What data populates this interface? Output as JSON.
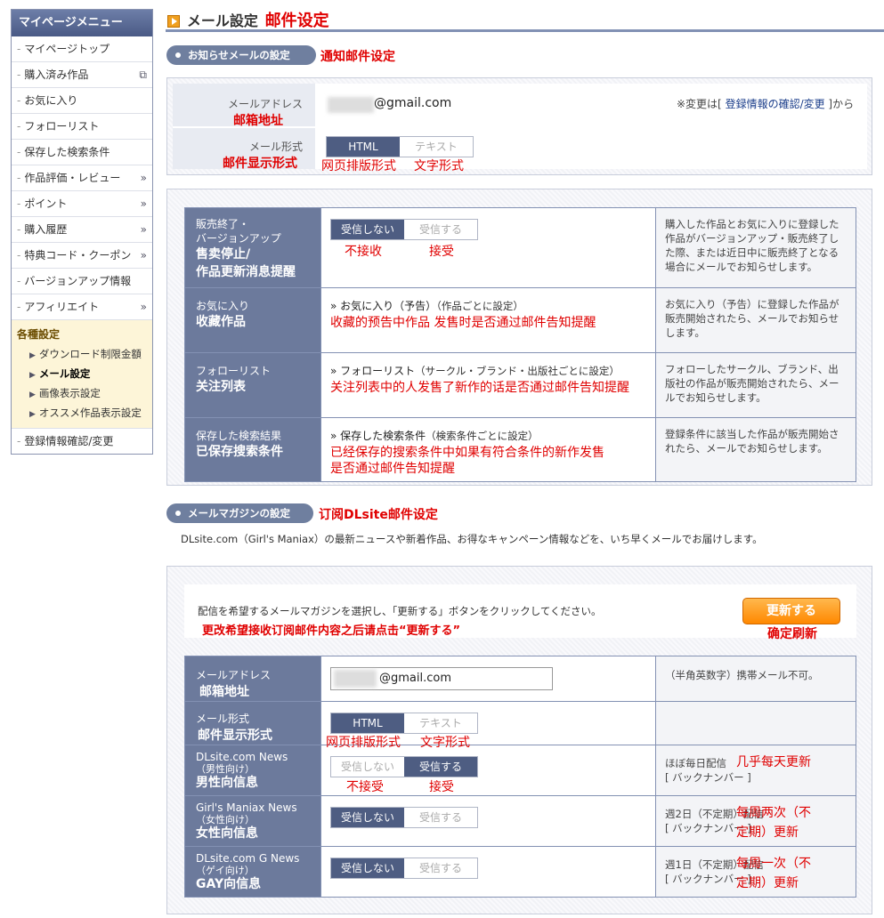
{
  "sidebar": {
    "title": "マイページメニュー",
    "items": [
      {
        "label": "マイページトップ",
        "arrow": ""
      },
      {
        "label": "購入済み作品",
        "arrow": "⧉"
      },
      {
        "label": "お気に入り",
        "arrow": ""
      },
      {
        "label": "フォローリスト",
        "arrow": ""
      },
      {
        "label": "保存した検索条件",
        "arrow": ""
      },
      {
        "label": "作品評価・レビュー",
        "arrow": "»"
      },
      {
        "label": "ポイント",
        "arrow": "»"
      },
      {
        "label": "購入履歴",
        "arrow": "»"
      },
      {
        "label": "特典コード・クーポン",
        "arrow": "»"
      },
      {
        "label": "バージョンアップ情報",
        "arrow": ""
      },
      {
        "label": "アフィリエイト",
        "arrow": "»"
      }
    ],
    "settings_title": "各種設定",
    "settings_items": [
      "ダウンロード制限金額",
      "メール設定",
      "画像表示設定",
      "オススメ作品表示設定"
    ],
    "last_item": "登録情報確認/変更"
  },
  "header": {
    "title": "メール設定",
    "title_zh": "邮件设定"
  },
  "notify": {
    "pill": "お知らせメールの設定",
    "pill_zh": "通知邮件设定",
    "email_label": "メールアドレス",
    "email_zh": "邮箱地址",
    "email_value": "@gmail.com",
    "change_note_pre": "※変更は[ ",
    "change_link": "登録情報の確認/変更",
    "change_note_post": " ]から",
    "format_label": "メール形式",
    "format_zh": "邮件显示形式",
    "html": "HTML",
    "text": "テキスト",
    "html_zh": "网页排版形式",
    "text_zh": "文字形式"
  },
  "rows": [
    {
      "label": "販売終了・\nバージョンアップ",
      "zh": "售卖停止/\n作品更新消息提醒",
      "off": "受信しない",
      "on": "受信する",
      "off_zh": "不接收",
      "on_zh": "接受",
      "desc": "購入した作品とお気に入りに登録した作品がバージョンアップ・販売終了した際、または近日中に販売終了となる場合にメールでお知らせします。"
    },
    {
      "label": "お気に入り",
      "zh": "收藏作品",
      "link": "» お気に入り（予告）",
      "link_note": "（作品ごとに設定）",
      "note_zh": "收藏的预告中作品 发售时是否通过邮件告知提醒",
      "desc": "お気に入り（予告）に登録した作品が販売開始されたら、メールでお知らせします。"
    },
    {
      "label": "フォローリスト",
      "zh": "关注列表",
      "link": "» フォローリスト",
      "link_note": "（サークル・ブランド・出版社ごとに設定）",
      "note_zh": "关注列表中的人发售了新作的话是否通过邮件告知提醒",
      "desc": "フォローしたサークル、ブランド、出版社の作品が販売開始されたら、メールでお知らせします。"
    },
    {
      "label": "保存した検索結果",
      "zh": "已保存搜索条件",
      "link": "» 保存した検索条件",
      "link_note": "（検索条件ごとに設定）",
      "note_zh": "已经保存的搜索条件中如果有符合条件的新作发售\n是否通过邮件告知提醒",
      "desc": "登録条件に該当した作品が販売開始されたら、メールでお知らせします。"
    }
  ],
  "magazine": {
    "pill": "メールマガジンの設定",
    "pill_zh": "订阅DLsite邮件设定",
    "intro": "DLsite.com（Girl's Maniax）の最新ニュースや新着作品、お得なキャンペーン情報などを、いち早くメールでお届けします。",
    "instr": "配信を希望するメールマガジンを選択し、「更新する」ボタンをクリックしてください。",
    "instr_zh": "更改希望接收订阅邮件内容之后请点击“更新する”",
    "update": "更新する",
    "update_zh": "确定刷新",
    "email_label": "メールアドレス",
    "email_zh": "邮箱地址",
    "email_value": "@gmail.com",
    "email_note": "（半角英数字）携帯メール不可。",
    "format_label": "メール形式",
    "format_zh": "邮件显示形式",
    "html": "HTML",
    "text": "テキスト",
    "html_zh": "网页排版形式",
    "text_zh": "文字形式",
    "news": [
      {
        "label": "DLsite.com News",
        "sub": "（男性向け）",
        "zh": "男性向信息",
        "off": "受信しない",
        "on": "受信する",
        "sel": "on",
        "off_zh": "不接受",
        "on_zh": "接受",
        "freq": "ほぼ毎日配信",
        "freq_zh": "几乎每天更新",
        "back": "[ バックナンバー ]"
      },
      {
        "label": "Girl's Maniax News",
        "sub": "（女性向け）",
        "zh": "女性向信息",
        "off": "受信しない",
        "on": "受信する",
        "sel": "off",
        "freq": "週2日（不定期）配信",
        "freq_zh": "每周两次（不\n定期）更新",
        "back": "[ バックナンバー ]"
      },
      {
        "label": "DLsite.com G News",
        "sub": "（ゲイ向け）",
        "zh": "GAY向信息",
        "off": "受信しない",
        "on": "受信する",
        "sel": "off",
        "freq": "週1日（不定期）配信",
        "freq_zh": "每周一次（不\n定期）更新",
        "back": "[ バックナンバー ]"
      }
    ]
  }
}
